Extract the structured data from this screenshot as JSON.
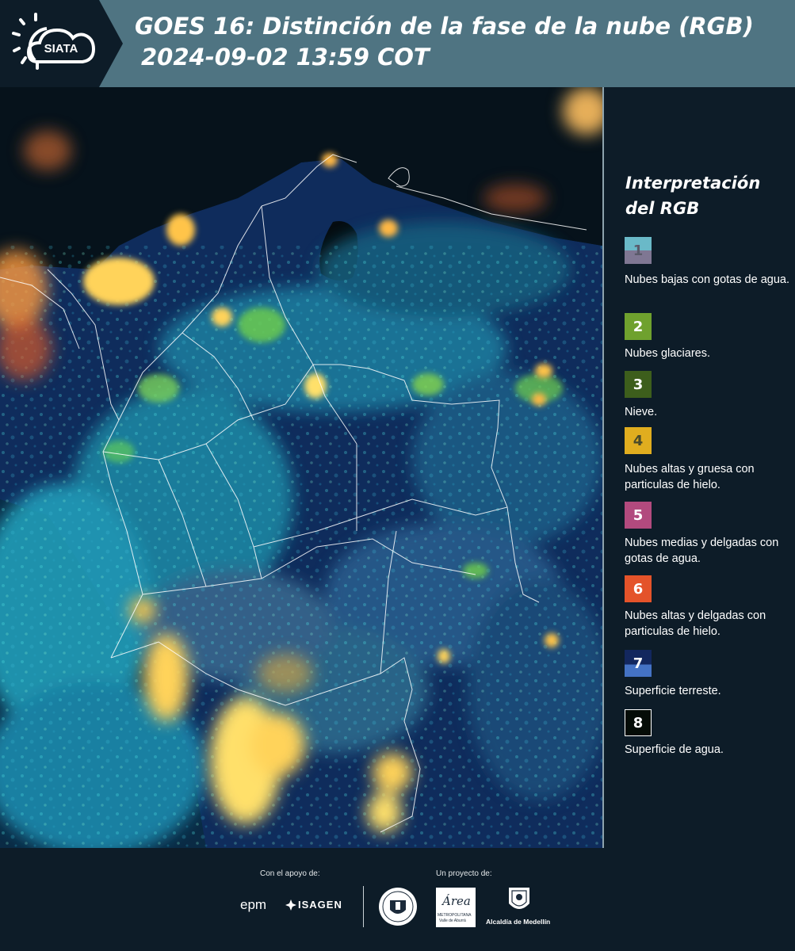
{
  "header": {
    "logo_text": "SIATA",
    "title_line1": "GOES 16: Distinción de la fase de la nube (RGB)",
    "title_line2": "2024-09-02 13:59 COT"
  },
  "legend": {
    "title": "Interpretación del RGB",
    "items": [
      {
        "number": "1",
        "label": "Nubes bajas con gotas de agua.",
        "color_top": "#6ab9c8",
        "color_bottom": "#7f7793",
        "text_color": "#5a5a6a"
      },
      {
        "number": "2",
        "label": "Nubes glaciares.",
        "color_top": "#6fa12e",
        "color_bottom": "#6fa12e",
        "text_color": "#ffffff"
      },
      {
        "number": "3",
        "label": "Nieve.",
        "color_top": "#3d5e1c",
        "color_bottom": "#3d5e1c",
        "text_color": "#ffffff"
      },
      {
        "number": "4",
        "label": "Nubes altas y gruesa con particulas de hielo.",
        "color_top": "#e0ad1f",
        "color_bottom": "#e0ad1f",
        "text_color": "#4a4a2a"
      },
      {
        "number": "5",
        "label": "Nubes medias y delgadas con gotas de agua.",
        "color_top": "#b24a7e",
        "color_bottom": "#b24a7e",
        "text_color": "#ffffff"
      },
      {
        "number": "6",
        "label": "Nubes altas y delgadas con particulas de hielo.",
        "color_top": "#e4532a",
        "color_bottom": "#e4532a",
        "text_color": "#ffffff"
      },
      {
        "number": "7",
        "label": "Superficie terreste.",
        "color_top": "#13275e",
        "color_bottom": "#4472c4",
        "text_color": "#ffffff"
      },
      {
        "number": "8",
        "label": "Superficie de agua.",
        "color_top": "#050c07",
        "color_bottom": "#050c07",
        "text_color": "#ffffff"
      }
    ]
  },
  "footer": {
    "support_label": "Con el apoyo de:",
    "project_label": "Un proyecto de:",
    "sponsor_epm": "epm",
    "sponsor_isagen": "ISAGEN",
    "area_name": "Área",
    "area_sub": "METROPOLITANA",
    "area_sub2": "Valle de Aburrá",
    "alcaldia": "Alcaldía de Medellín"
  },
  "colors": {
    "header_bg": "#4f7482",
    "panel_bg": "#0d1c28"
  }
}
